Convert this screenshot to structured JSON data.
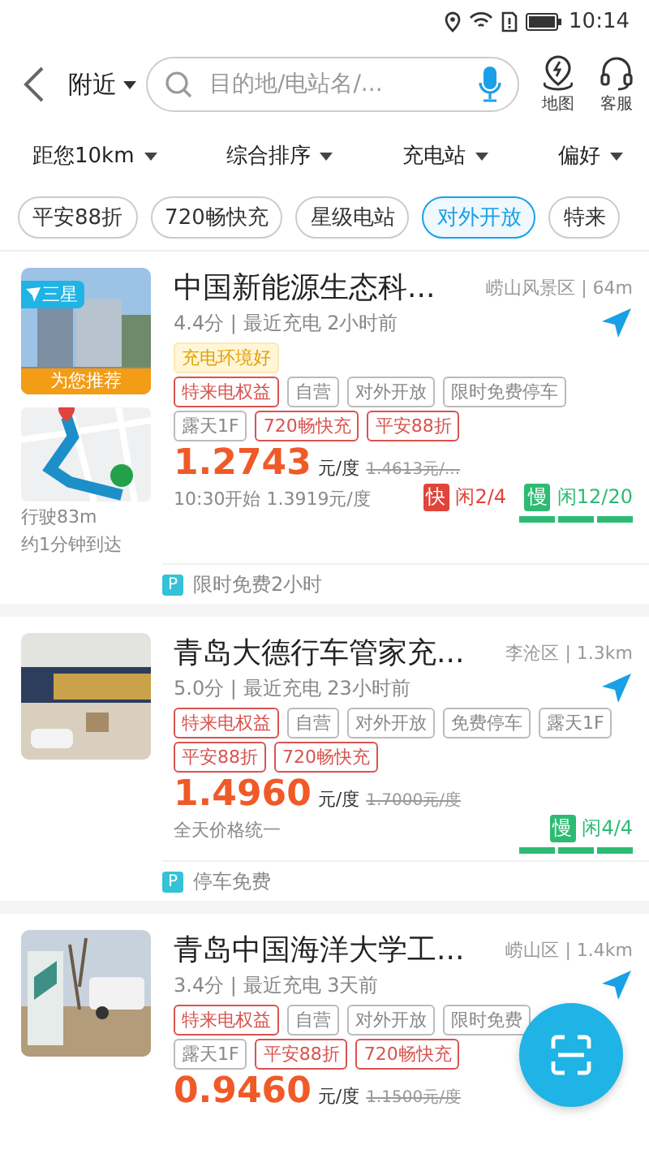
{
  "status_bar": {
    "time": "10:14"
  },
  "header": {
    "location": "附近",
    "search": {
      "placeholder": "目的地/电站名/..."
    },
    "actions": [
      {
        "kind": "map",
        "label": "地图"
      },
      {
        "kind": "service",
        "label": "客服"
      }
    ]
  },
  "filters": [
    "距您10km",
    "综合排序",
    "充电站",
    "偏好"
  ],
  "chips": [
    {
      "label": "平安88折",
      "selected": false
    },
    {
      "label": "720畅快充",
      "selected": false
    },
    {
      "label": "星级电站",
      "selected": false
    },
    {
      "label": "对外开放",
      "selected": true
    },
    {
      "label": "特来",
      "selected": false
    }
  ],
  "stations": [
    {
      "title": "中国新能源生态科...",
      "location": "崂山风景区 | 64m",
      "rating": "4.4分 | 最近充电 2小时前",
      "nav": true,
      "star_badge": "三星",
      "recommend": "为您推荐",
      "route": {
        "distance": "行驶83m",
        "eta": "约1分钟到达"
      },
      "tags": [
        {
          "kind": "highlight",
          "text": "充电环境好"
        },
        {
          "kind": "break"
        },
        {
          "kind": "promo",
          "text": "特来电权益"
        },
        {
          "kind": "plain",
          "text": "自营"
        },
        {
          "kind": "plain",
          "text": "对外开放"
        },
        {
          "kind": "plain",
          "text": "限时免费停车"
        },
        {
          "kind": "break"
        },
        {
          "kind": "plain",
          "text": "露天1F"
        },
        {
          "kind": "promo",
          "text": "720畅快充"
        },
        {
          "kind": "promo",
          "text": "平安88折"
        }
      ],
      "price": "1.2743",
      "unit": "元/度",
      "old_price": "1.4613元/...",
      "note": "10:30开始 1.3919元/度",
      "chargers": [
        {
          "kind": "fast",
          "badge": "快",
          "status": "闲2/4"
        },
        {
          "kind": "slow",
          "badge": "慢",
          "status": "闲12/20"
        }
      ],
      "parking": {
        "badge": "P",
        "text": "限时免费2小时"
      }
    },
    {
      "title": "青岛大德行车管家充...",
      "location": "李沧区 | 1.3km",
      "rating": "5.0分 | 最近充电 23小时前",
      "nav": true,
      "tags": [
        {
          "kind": "promo",
          "text": "特来电权益"
        },
        {
          "kind": "plain",
          "text": "自营"
        },
        {
          "kind": "plain",
          "text": "对外开放"
        },
        {
          "kind": "plain",
          "text": "免费停车"
        },
        {
          "kind": "plain",
          "text": "露天1F"
        },
        {
          "kind": "break"
        },
        {
          "kind": "promo",
          "text": "平安88折"
        },
        {
          "kind": "promo",
          "text": "720畅快充"
        }
      ],
      "price": "1.4960",
      "unit": "元/度",
      "old_price": "1.7000元/度",
      "note": "全天价格统一",
      "chargers": [
        {
          "kind": "slow",
          "badge": "慢",
          "status": "闲4/4"
        }
      ],
      "parking": {
        "badge": "P",
        "text": "停车免费"
      }
    },
    {
      "title": "青岛中国海洋大学工...",
      "location": "崂山区 | 1.4km",
      "rating": "3.4分 | 最近充电 3天前",
      "nav": true,
      "tags": [
        {
          "kind": "promo",
          "text": "特来电权益"
        },
        {
          "kind": "plain",
          "text": "自营"
        },
        {
          "kind": "plain",
          "text": "对外开放"
        },
        {
          "kind": "plain",
          "text": "限时免费"
        },
        {
          "kind": "break"
        },
        {
          "kind": "plain",
          "text": "露天1F"
        },
        {
          "kind": "promo",
          "text": "平安88折"
        },
        {
          "kind": "promo",
          "text": "720畅快充"
        }
      ],
      "price": "0.9460",
      "unit": "元/度",
      "old_price": "1.1500元/度"
    }
  ]
}
